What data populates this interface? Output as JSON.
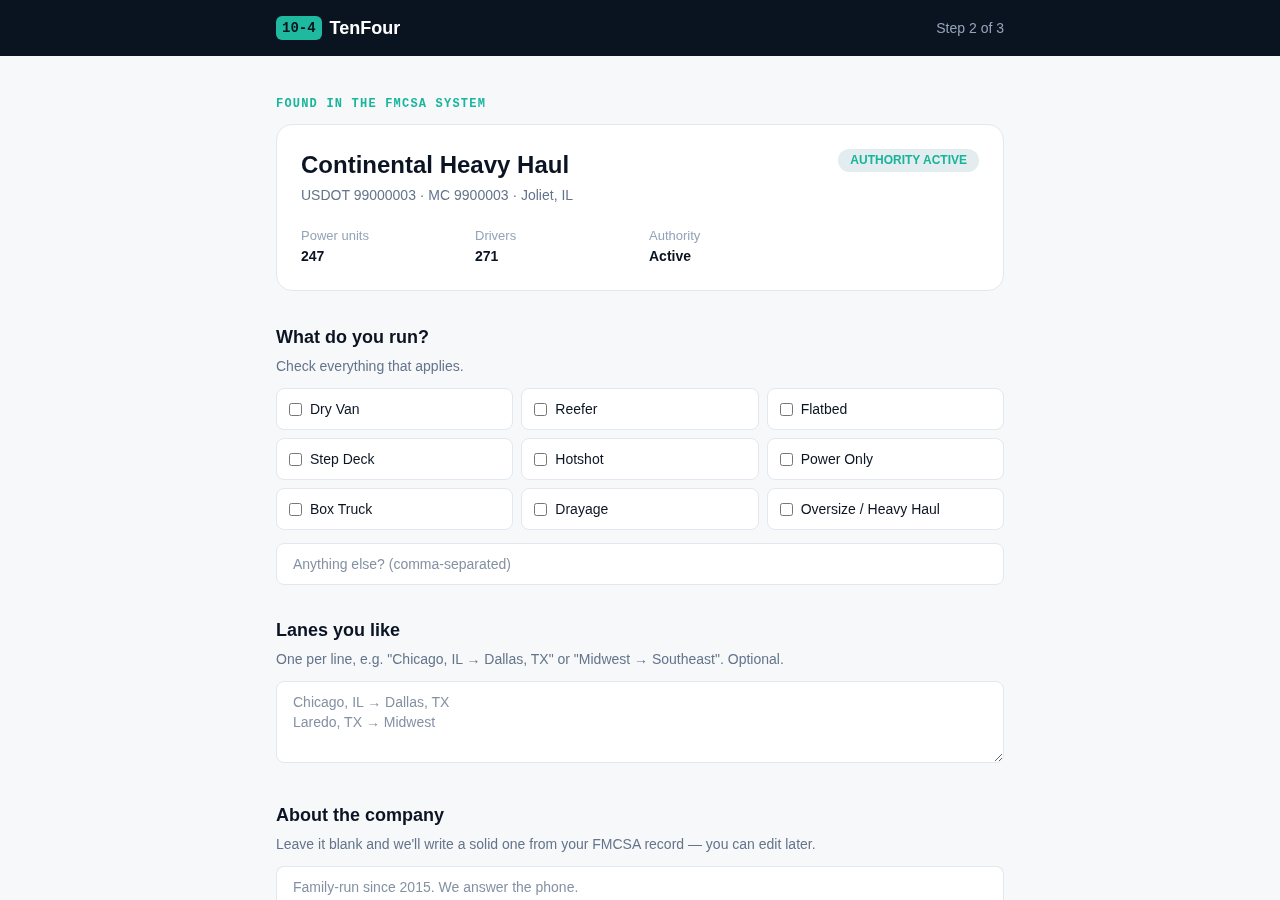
{
  "header": {
    "logo_mark": "10-4",
    "brand": "TenFour",
    "step": "Step 2 of 3"
  },
  "carrier": {
    "eyebrow": "FOUND IN THE FMCSA SYSTEM",
    "name": "Continental Heavy Haul",
    "badge": "AUTHORITY ACTIVE",
    "details": "USDOT 99000003 · MC 9900003 · Joliet, IL",
    "stats": [
      {
        "label": "Power units",
        "value": "247"
      },
      {
        "label": "Drivers",
        "value": "271"
      },
      {
        "label": "Authority",
        "value": "Active"
      }
    ]
  },
  "equipment": {
    "title": "What do you run?",
    "hint": "Check everything that applies.",
    "options": [
      {
        "label": "Dry Van",
        "checked": false
      },
      {
        "label": "Reefer",
        "checked": false
      },
      {
        "label": "Flatbed",
        "checked": false
      },
      {
        "label": "Step Deck",
        "checked": false
      },
      {
        "label": "Hotshot",
        "checked": false
      },
      {
        "label": "Power Only",
        "checked": false
      },
      {
        "label": "Box Truck",
        "checked": false
      },
      {
        "label": "Drayage",
        "checked": false
      },
      {
        "label": "Oversize / Heavy Haul",
        "checked": false
      }
    ],
    "other": {
      "placeholder": "Anything else? (comma-separated)"
    }
  },
  "lanes": {
    "title": "Lanes you like",
    "hint": "One per line, e.g. \"Chicago, IL → Dallas, TX\" or \"Midwest → Southeast\". Optional.",
    "field": {
      "placeholder": "Chicago, IL → Dallas, TX\nLaredo, TX → Midwest"
    }
  },
  "about": {
    "title": "About the company",
    "hint": "Leave it blank and we'll write a solid one from your FMCSA record — you can edit later.",
    "field": {
      "placeholder": "Family-run since 2015. We answer the phone."
    }
  }
}
